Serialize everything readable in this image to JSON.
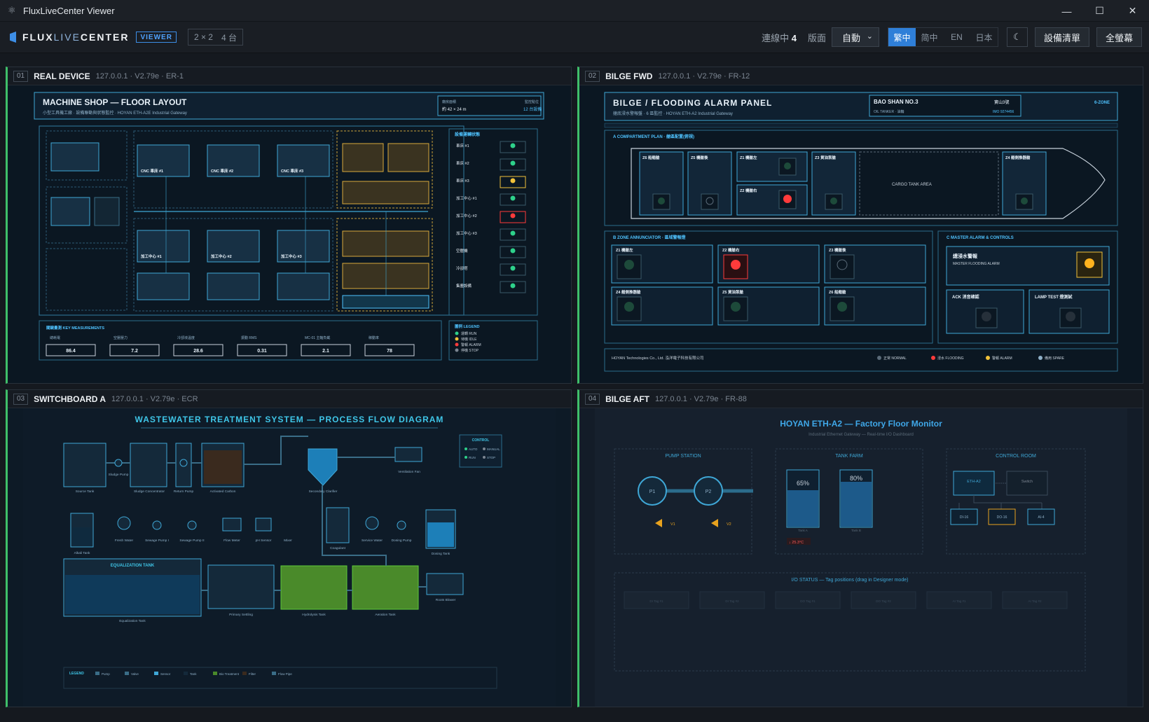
{
  "window": {
    "title": "FluxLiveCenter Viewer"
  },
  "appbar": {
    "brand_bold": "FLUX",
    "brand_thin": "LIVE",
    "brand_rest": "CENTER",
    "badge": "VIEWER",
    "layout_grid": "2 × 2",
    "layout_count": "4 台",
    "connected_label": "連線中",
    "connected_count": "4",
    "version_label": "版面",
    "version_value": "自動",
    "languages": [
      "繁中",
      "简中",
      "EN",
      "日本"
    ],
    "active_language": "繁中",
    "device_list_button": "設備清單",
    "fullscreen_button": "全螢幕"
  },
  "panels": [
    {
      "num": "01",
      "name": "REAL DEVICE",
      "info": "127.0.0.1 · V2.79e · ER-1",
      "title": "MACHINE SHOP — FLOOR LAYOUT",
      "subtitle": "小型工具機工廠 · 設備聯動與狀態監控 · HOYAN ETH-A2E Industrial Gateway",
      "corner_left": "廠房面積",
      "corner_left_value": "約 42 × 24 m",
      "corner_right": "監控點位",
      "corner_right_value": "12 台設備",
      "cnc_labels": [
        "CNC 車床 #1",
        "CNC 車床 #2",
        "CNC 車床 #3"
      ],
      "mill_labels": [
        "加工中心 #1",
        "加工中心 #2",
        "加工中心 #3"
      ],
      "status_title": "設備運轉狀態",
      "status_items": [
        "車床 #1",
        "車床 #2",
        "車床 #3",
        "加工中心 #1",
        "加工中心 #2",
        "加工中心 #3",
        "空壓機",
        "冷卻塔",
        "集塵設備"
      ],
      "status_colors": [
        "#2ed18b",
        "#2ed18b",
        "#f2c23a",
        "#2ed18b",
        "#ff3b3b",
        "#2ed18b",
        "#2ed18b",
        "#2ed18b",
        "#2ed18b"
      ],
      "measure_title": "關鍵量測 KEY MEASUREMENTS",
      "measure_labels": [
        "總耗電",
        "空壓壓力",
        "冷卻液溫度",
        "振動 RMS",
        "MC-01 主軸負載",
        "稼動率"
      ],
      "measure_values": [
        "86.4",
        "7.2",
        "28.6",
        "0.31",
        "2.1",
        "78"
      ],
      "legend_title": "圖例 LEGEND",
      "legend_items": [
        "運轉 RUN",
        "待機 IDLE",
        "警報 ALARM",
        "停機 STOP"
      ]
    },
    {
      "num": "02",
      "name": "BILGE FWD",
      "info": "127.0.0.1 · V2.79e · FR-12",
      "title": "BILGE / FLOODING ALARM PANEL",
      "subtitle": "艙底浸水警報盤 · 6 區監控 · HOYAN ETH-A2 Industrial Gateway",
      "ship_name": "BAO SHAN NO.3",
      "ship_name_zh": "寶山3號",
      "ship_type": "OIL TANKER · 油輪",
      "imo": "IMO 9274456",
      "zone_tag": "6-ZONE",
      "plan_title": "A COMPARTMENT PLAN · 艙區配置(俯視)",
      "cargo": "CARGO TANK AREA",
      "compartments": [
        "Z6 船艏艙",
        "Z5 機艙後",
        "Z1 機艙左",
        "Z2 機艙右",
        "Z3 貨油泵艙",
        "Z4 艏側推器艙"
      ],
      "annun_title": "B ZONE ANNUNCIATOR · 區域警報燈",
      "zones": [
        "Z1 機艙左",
        "Z2 機艙右",
        "Z3 機艙後",
        "Z4 艏側推器艙",
        "Z5 貨油泵艙",
        "Z6 船艏艙"
      ],
      "master_title": "C MASTER ALARM & CONTROLS",
      "master_label": "總浸水警報",
      "master_sub": "MASTER FLOODING ALARM",
      "ack": "ACK 消音確認",
      "lamp_test": "LAMP TEST 燈測試",
      "footer_left": "HOYAN Technologies Co., Ltd. 泓洋電子科技有限公司",
      "legend_items": [
        "正常 NORMAL",
        "浸水 FLOODING",
        "警報 ALARM",
        "備用 SPARE"
      ]
    },
    {
      "num": "03",
      "name": "SWITCHBOARD A",
      "info": "127.0.0.1 · V2.79e · ECR",
      "title": "WASTEWATER TREATMENT SYSTEM — PROCESS FLOW DIAGRAM",
      "labels": [
        "Source Tank",
        "Sludge Pump",
        "Sludge Concentrator",
        "Return Pump",
        "Activated Carbon",
        "Secondary Clarifier",
        "Ventilation Fan",
        "Alkali Tank",
        "Fresh Water",
        "Sewage Pump I",
        "Sewage Pump II",
        "Flow Meter",
        "pH Sensor",
        "Mixer",
        "Coagulant",
        "Service Water",
        "Dosing Pump",
        "Dosing Tank",
        "Equalization Tank",
        "Primary Settling",
        "Hydrolysis Tank",
        "Aeration Tank",
        "Roots Blower"
      ],
      "eq_title": "EQUALIZATION TANK",
      "control_title": "CONTROL",
      "control_items": [
        "AUTO",
        "MANUAL",
        "RUN",
        "STOP"
      ],
      "legend_title": "LEGEND",
      "legend_items": [
        "Pump",
        "Valve",
        "Sensor",
        "Tank",
        "Bio Treatment",
        "Filter",
        "Flow Pipe"
      ]
    },
    {
      "num": "04",
      "name": "BILGE AFT",
      "info": "127.0.0.1 · V2.79e · FR-88",
      "title": "HOYAN ETH-A2 — Factory Floor Monitor",
      "subtitle": "Industrial Ethernet Gateway — Real-time I/O Dashboard",
      "pump_station": "PUMP STATION",
      "tank_farm": "TANK FARM",
      "control_room": "CONTROL ROOM",
      "pumps": [
        "P1",
        "P2"
      ],
      "valves": [
        "V1",
        "V2"
      ],
      "tank_a": "65%",
      "tank_b": "80%",
      "tank_a_label": "Tank A",
      "tank_b_label": "Tank B",
      "temp": "↓ 25.3°C",
      "io_title": "I/O STATUS — Tag positions (drag in Designer mode)",
      "io_tags": [
        "DI Tag #1",
        "DI Tag #2",
        "DO Tag #1",
        "DO Tag #2",
        "AI Tag #1",
        "AI Tag #2"
      ],
      "gateway": "ETH-A2",
      "switch": "Switch",
      "nodes": [
        "DI-16",
        "DO-16",
        "AI-4"
      ],
      "progress": {
        "tank_a": 0.65,
        "tank_b": 0.8
      }
    }
  ]
}
